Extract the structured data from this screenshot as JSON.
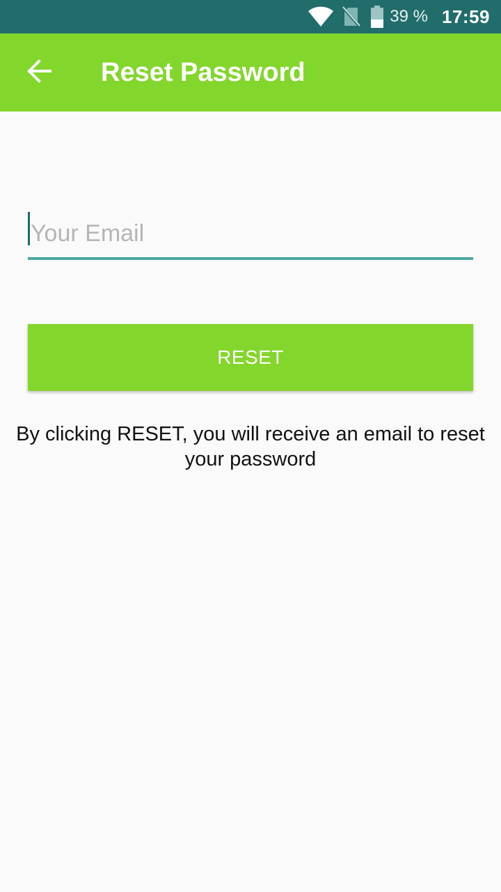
{
  "status_bar": {
    "battery_percent": "39 %",
    "time": "17:59",
    "icons": [
      "wifi-icon",
      "no-sim-icon",
      "battery-icon"
    ],
    "background": "#216d6c"
  },
  "app_bar": {
    "title": "Reset Password",
    "back_icon": "arrow-left-icon",
    "background": "#83d62c"
  },
  "form": {
    "email": {
      "placeholder": "Your Email",
      "value": ""
    },
    "reset_button_label": "RESET",
    "info_text": "By clicking RESET, you will receive an email to reset your password"
  },
  "colors": {
    "accent": "#83d62c",
    "primary_dark": "#216d6c",
    "input_underline": "#4aa8a2"
  }
}
